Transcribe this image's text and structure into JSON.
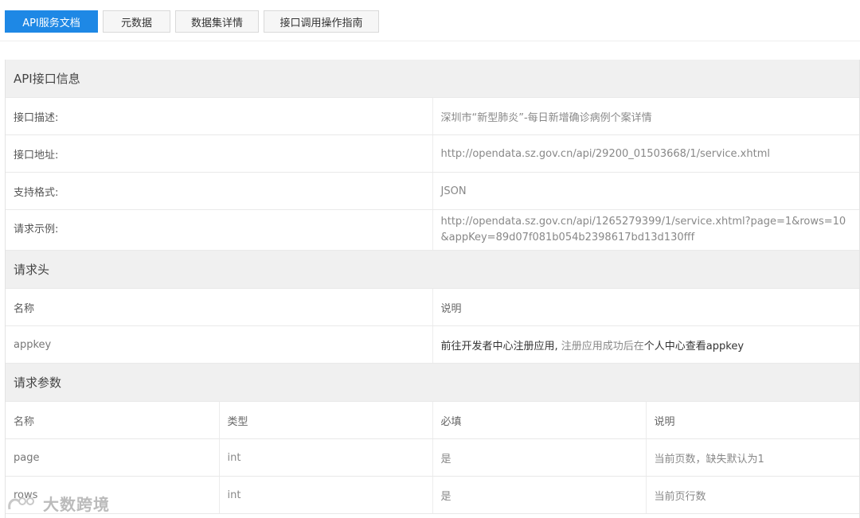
{
  "tabs": [
    {
      "label": "API服务文档",
      "active": true
    },
    {
      "label": "元数据",
      "active": false
    },
    {
      "label": "数据集详情",
      "active": false
    },
    {
      "label": "接口调用操作指南",
      "active": false
    }
  ],
  "api_info": {
    "title": "API接口信息",
    "rows": [
      {
        "key": "接口描述:",
        "value": "深圳市“新型肺炎”-每日新增确诊病例个案详情"
      },
      {
        "key": "接口地址:",
        "value": "http://opendata.sz.gov.cn/api/29200_01503668/1/service.xhtml"
      },
      {
        "key": "支持格式:",
        "value": "JSON"
      },
      {
        "key": "请求示例:",
        "value": "http://opendata.sz.gov.cn/api/1265279399/1/service.xhtml?page=1&rows=10&appKey=89d07f081b054b2398617bd13d130fff"
      }
    ]
  },
  "request_header": {
    "title": "请求头",
    "columns": [
      "名称",
      "说明"
    ],
    "rows": [
      {
        "name": "appkey",
        "desc_part1": "前往开发者中心注册应用,",
        "desc_part2": " 注册应用成功后在",
        "desc_part3": "个人中心查看appkey"
      }
    ]
  },
  "request_params": {
    "title": "请求参数",
    "columns": [
      "名称",
      "类型",
      "必填",
      "说明"
    ],
    "rows": [
      [
        "page",
        "int",
        "是",
        "当前页数，缺失默认为1"
      ],
      [
        "rows",
        "int",
        "是",
        "当前页行数"
      ]
    ]
  },
  "watermark": {
    "text": "大数跨境"
  },
  "colors": {
    "accent": "#1e88e5",
    "section_bg": "#f0f0f0",
    "border": "#e9e9e9"
  }
}
